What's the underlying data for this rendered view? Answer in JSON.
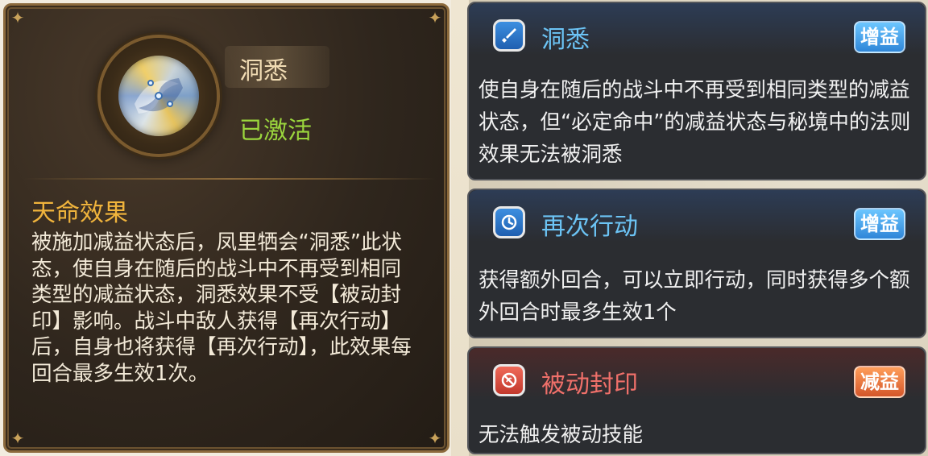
{
  "left_panel": {
    "skill_name": "洞悉",
    "status": "已激活",
    "section_title": "天命效果",
    "description": "被施加减益状态后，凤里牺会“洞悉”此状态，使自身在随后的战斗中不再受到相同类型的减益状态，洞悉效果不受【被动封印】影响。战斗中敌人获得【再次行动】后，自身也将获得【再次行动】，此效果每回合最多生效1次。"
  },
  "cards": [
    {
      "icon": "sword-icon",
      "title": "洞悉",
      "tag": "增益",
      "description": "使自身在随后的战斗中不再受到相同类型的减益状态，但“必定命中”的减益状态与秘境中的法则效果无法被洞悉"
    },
    {
      "icon": "clock-icon",
      "title": "再次行动",
      "tag": "增益",
      "description": "获得额外回合，可以立即行动，同时获得多个额外回合时最多生效1个"
    },
    {
      "icon": "no-spell-icon",
      "title": "被动封印",
      "tag": "减益",
      "description": "无法触发被动技能"
    }
  ],
  "colors": {
    "buff_badge": "#2f86d8",
    "debuff_badge": "#d4562a",
    "buff_title": "#6cc4f5",
    "debuff_title": "#f0706a",
    "active_status": "#9bd63d",
    "section_title": "#f0b43c"
  }
}
